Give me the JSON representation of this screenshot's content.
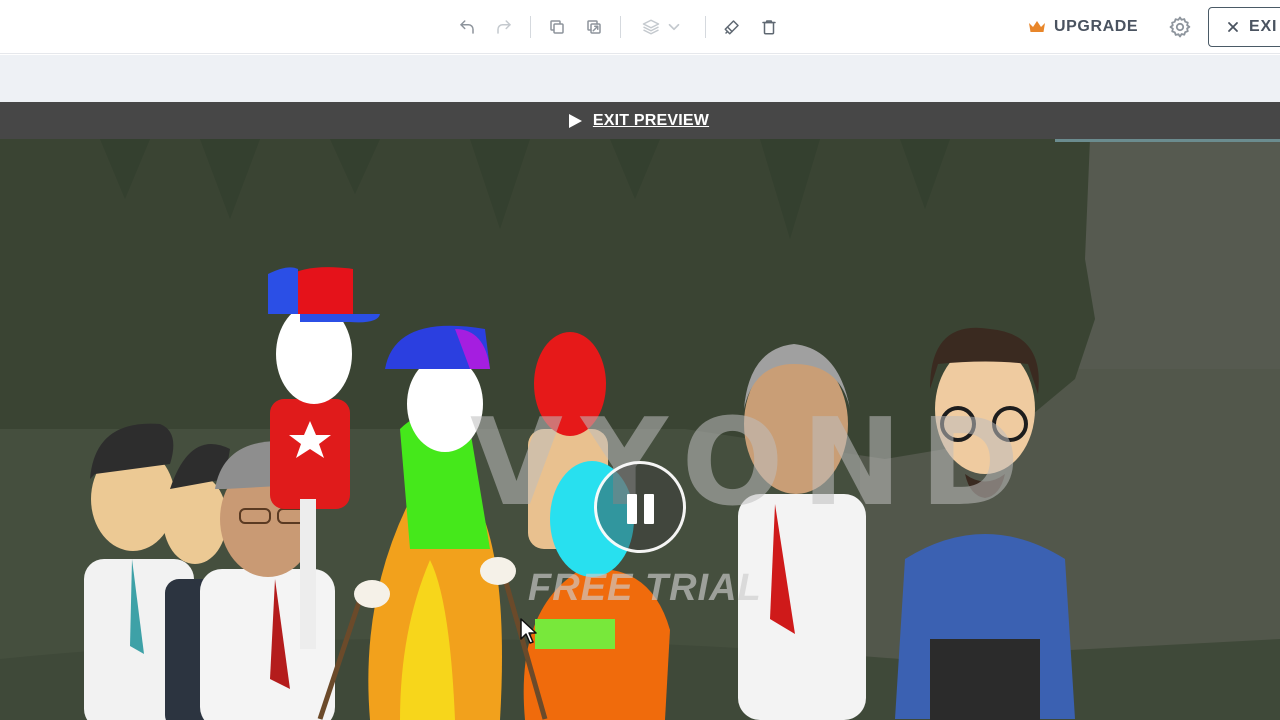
{
  "toolbar": {
    "icons": {
      "undo": "undo-icon",
      "redo": "redo-icon",
      "copy": "copy-icon",
      "duplicate": "duplicate-icon",
      "layers": "layers-icon",
      "layers_dropdown": "chevron-down-icon",
      "brush": "brush-icon",
      "delete": "trash-icon",
      "settings": "gear-icon",
      "close": "close-icon"
    },
    "upgrade_label": "UPGRADE",
    "exit_label": "EXI"
  },
  "preview": {
    "exit_preview_label": "EXIT PREVIEW"
  },
  "stage": {
    "watermark_logo": "VYOND",
    "watermark_sub": "FREE TRIAL"
  },
  "colors": {
    "accent_crown": "#e8862a",
    "preview_bar": "#474747",
    "stage_background": "#46503f"
  }
}
